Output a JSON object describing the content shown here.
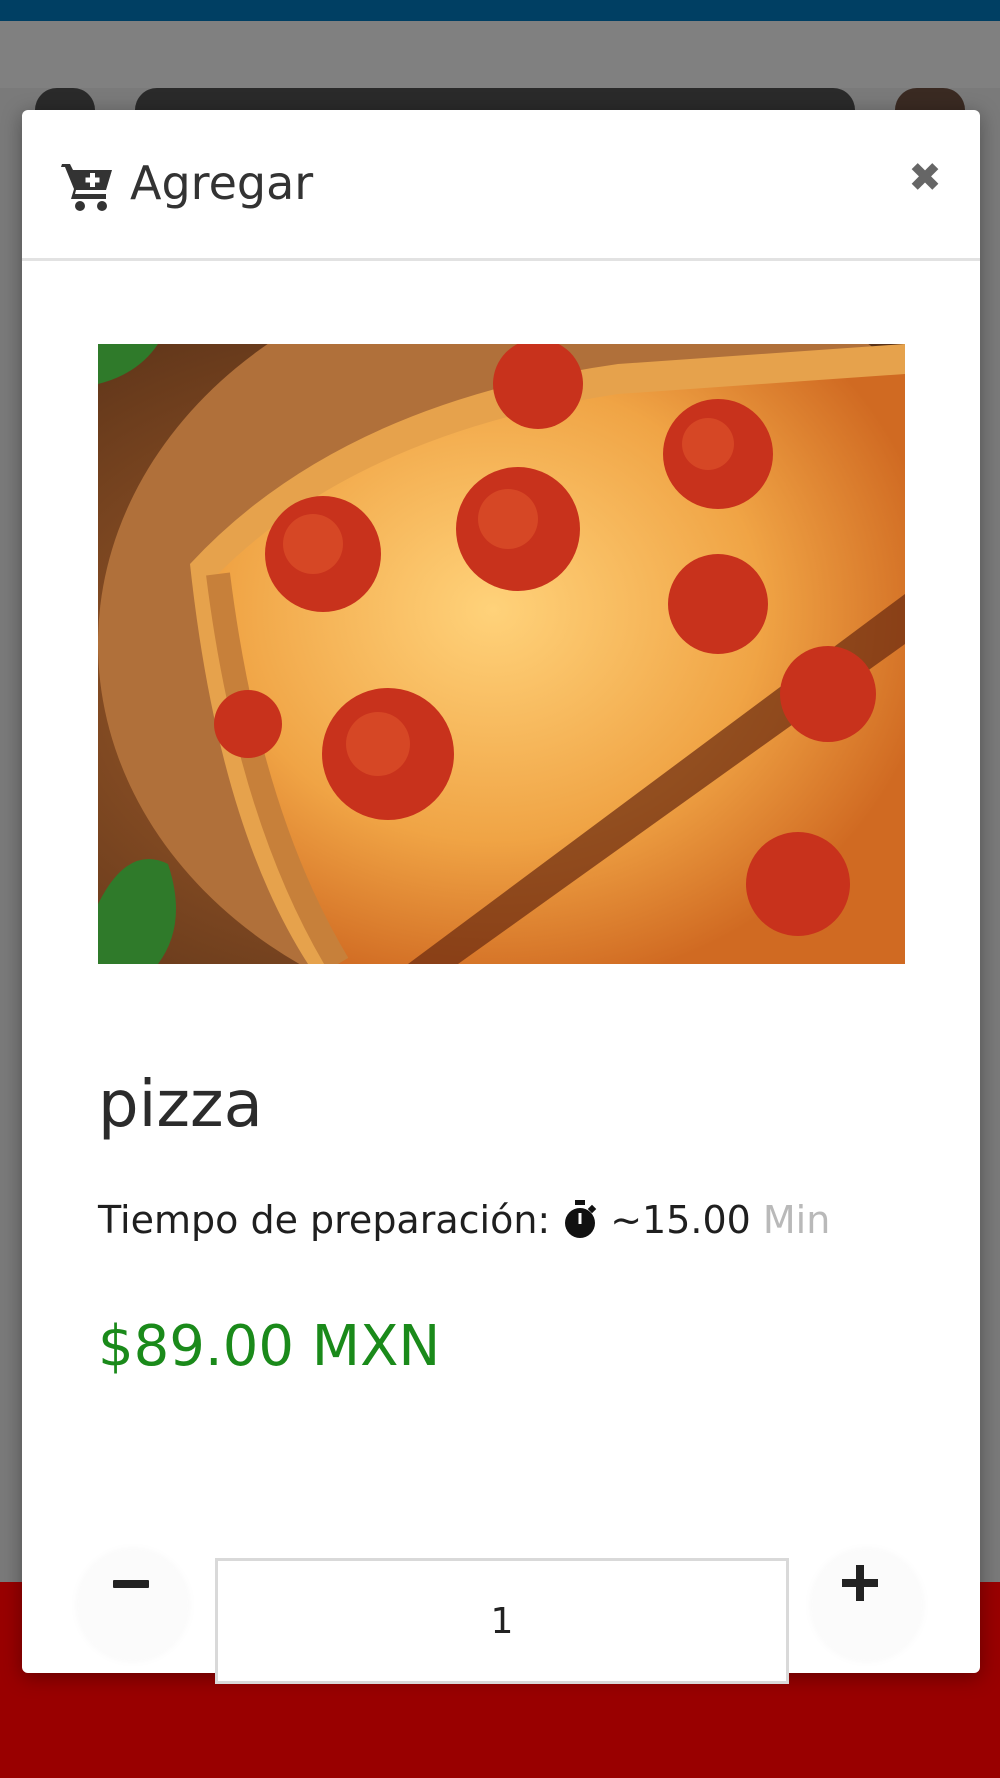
{
  "modal": {
    "title": "Agregar",
    "close_symbol": "✖",
    "cart_icon": "cart-plus-icon"
  },
  "product": {
    "image_alt": "Pizza de pepperoni",
    "name": "pizza",
    "prep_label": "Tiempo de preparación:",
    "prep_icon": "stopwatch-icon",
    "prep_time": "~15.00",
    "prep_unit": "Min",
    "price": "$89.00 MXN"
  },
  "quantity": {
    "value": "1",
    "minus_icon": "minus-icon",
    "plus_icon": "plus-icon"
  },
  "colors": {
    "top_bar": "#003f63",
    "price_green": "#1a8a1a",
    "footer_red": "#990000",
    "overlay_gray": "#7f7f7f"
  }
}
